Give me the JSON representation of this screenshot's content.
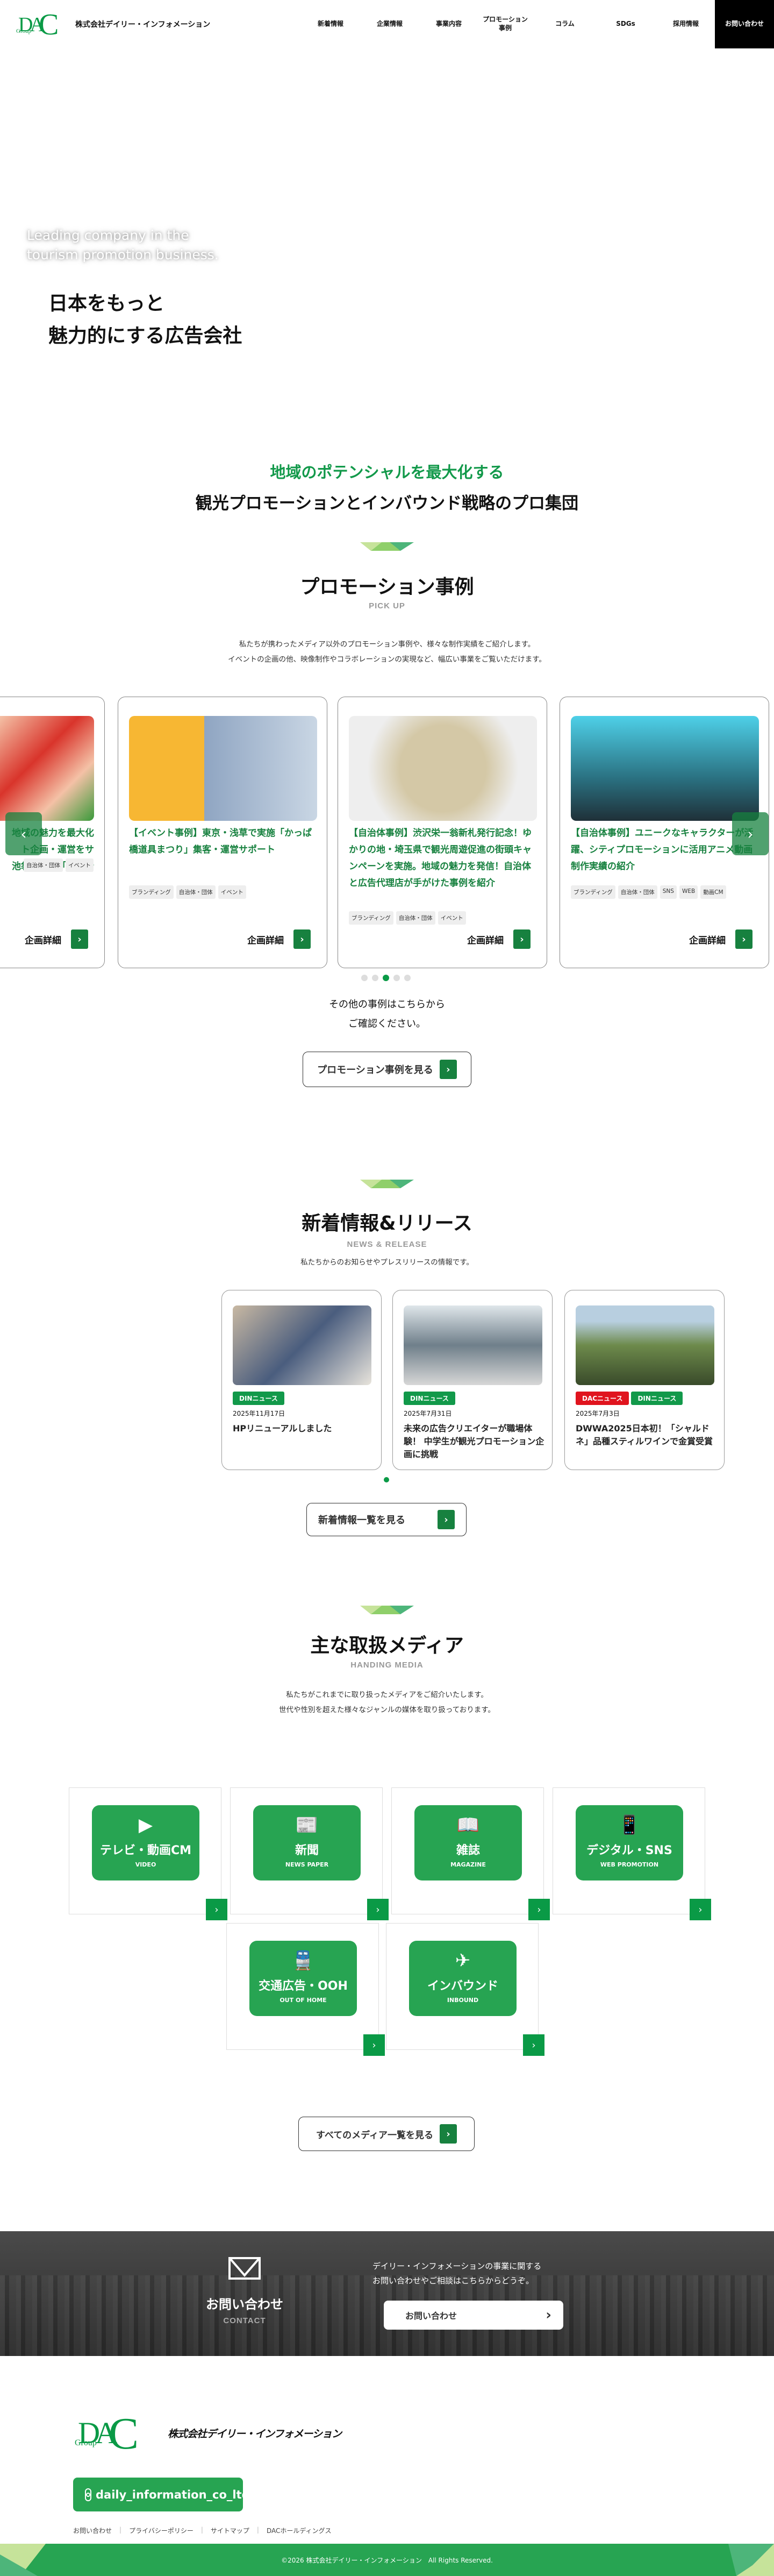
{
  "header": {
    "company": "株式会社デイリー・インフォメーション",
    "logo_text": {
      "main": "DAC",
      "sub": "Group"
    },
    "nav": [
      "新着情報",
      "企業情報",
      "事業内容",
      "プロモーション事例",
      "コラム",
      "SDGs",
      "採用情報"
    ],
    "contact": "お問い合わせ"
  },
  "hero": {
    "en_line1": "Leading company in the",
    "en_line2": "tourism promotion business.",
    "jp_line1": "日本をもっと",
    "jp_line2": "魅力的にする広告会社"
  },
  "intro": {
    "tagline_green": "地域のポテンシャルを最大化する",
    "tagline_black": "観光プロモーションとインバウンド戦略のプロ集団"
  },
  "promotion": {
    "title": "プロモーション事例",
    "subtitle": "PICK UP",
    "desc1": "私たちが携わったメディア以外のプロモーション事例や、様々な制作実績をご紹介します。",
    "desc2": "イベントの企画の他、映像制作やコラボレーションの実現など、幅広い事業をご覧いただけます。",
    "cards": [
      {
        "title": "地域の魅力を最大化\nト企画・運営をサ\n池袋で実施「大養老",
        "tags": [
          "自治体・団体",
          "イベント"
        ],
        "more": "企画詳細"
      },
      {
        "title": "【イベント事例】東京・浅草で実施「かっぱ橋道具まつり」集客・運営サポート",
        "tags": [
          "ブランディング",
          "自治体・団体",
          "イベント"
        ],
        "more": "企画詳細"
      },
      {
        "title": "【自治体事例】渋沢栄一翁新札発行記念！ゆかりの地・埼玉県で観光周遊促進の街頭キャンペーンを実施。地域の魅力を発信！自治体と広告代理店が手がけた事例を紹介",
        "tags": [
          "ブランディング",
          "自治体・団体",
          "イベント"
        ],
        "more": "企画詳細"
      },
      {
        "title": "【自治体事例】ユニークなキャラクターが活躍、シティプロモーションに活用アニメ動画制作実績の紹介",
        "tags": [
          "ブランディング",
          "自治体・団体",
          "SNS",
          "WEB",
          "動画CM"
        ],
        "more": "企画詳細"
      }
    ],
    "active_slide": 3,
    "slide_count": 5,
    "more_text1": "その他の事例はこちらから",
    "more_text2": "ご確認ください。",
    "button": "プロモーション事例を見る"
  },
  "news": {
    "title": "新着情報&リリース",
    "subtitle": "NEWS & RELEASE",
    "desc": "私たちからのお知らせやプレスリリースの情報です。",
    "items": [
      {
        "badges": [
          {
            "label": "DINニュース",
            "color": "#12994a"
          }
        ],
        "date": "2025年11月17日",
        "title": "HPリニューアルしました"
      },
      {
        "badges": [
          {
            "label": "DINニュース",
            "color": "#12994a"
          }
        ],
        "date": "2025年7月31日",
        "title": "未来の広告クリエイターが職場体験！ 中学生が観光プロモーション企画に挑戦"
      },
      {
        "badges": [
          {
            "label": "DACニュース",
            "color": "#e0141e"
          },
          {
            "label": "DINニュース",
            "color": "#12994a"
          }
        ],
        "date": "2025年7月3日",
        "title": "DWWA2025日本初！「シャルドネ」品種スティルワインで金賞受賞"
      }
    ],
    "button": "新着情報一覧を見る"
  },
  "media": {
    "title": "主な取扱メディア",
    "subtitle": "HANDING MEDIA",
    "desc1": "私たちがこれまでに取り扱ったメディアをご紹介いたします。",
    "desc2": "世代や性別を超えた様々なジャンルの媒体を取り扱っております。",
    "items": [
      {
        "jp": "テレビ・動画CM",
        "en": "VIDEO",
        "icon": "video-icon"
      },
      {
        "jp": "新聞",
        "en": "NEWS PAPER",
        "icon": "newspaper-icon"
      },
      {
        "jp": "雑誌",
        "en": "MAGAZINE",
        "icon": "magazine-icon"
      },
      {
        "jp": "デジタル・SNS",
        "en": "WEB PROMOTION",
        "icon": "smartphone-icon"
      },
      {
        "jp": "交通広告・OOH",
        "en": "OUT OF HOME",
        "icon": "train-icon"
      },
      {
        "jp": "インバウンド",
        "en": "INBOUND",
        "icon": "airplane-icon"
      }
    ],
    "button": "すべてのメディア一覧を見る"
  },
  "contact": {
    "title": "お問い合わせ",
    "subtitle": "CONTACT",
    "text1": "デイリー・インフォメーションの事業に関する",
    "text2": "お問い合わせやご相談はこちらからどうぞ。",
    "button": "お問い合わせ"
  },
  "footer": {
    "company_logo_text": "株式会社デイリー・インフォメーション",
    "instagram": "daily_information_co_ltd",
    "links": [
      "お問い合わせ",
      "プライバシーポリシー",
      "サイトマップ",
      "DACホールディングス"
    ],
    "copyright": "©2026 株式会社デイリー・インフォメーション　All Rights Reserved."
  },
  "colors": {
    "brand_green": "#12994a",
    "dark_green": "#17813f",
    "tile_green": "#27a452",
    "dac_red": "#e0141e"
  }
}
